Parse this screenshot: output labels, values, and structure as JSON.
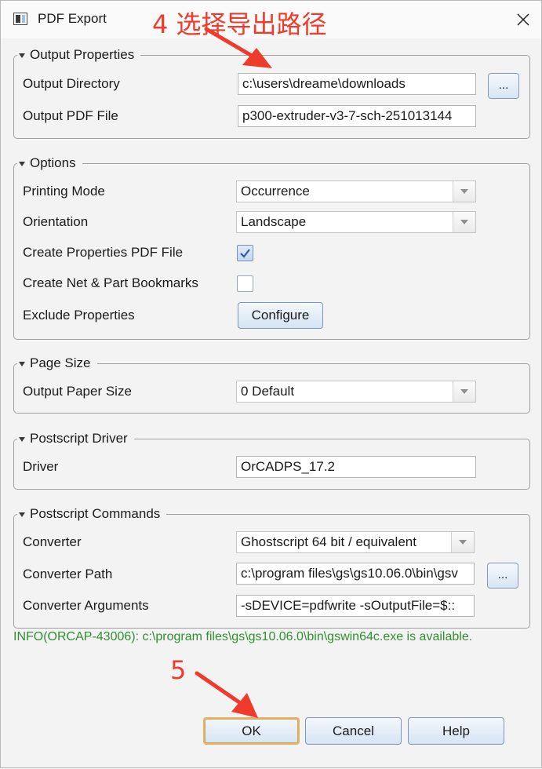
{
  "window": {
    "title": "PDF Export"
  },
  "annotations": {
    "step4": "4  选择导出路径",
    "step5": "5"
  },
  "output_properties": {
    "legend": "Output Properties",
    "dir_label": "Output Directory",
    "dir_value": "c:\\users\\dreame\\downloads",
    "browse_label": "...",
    "pdf_label": "Output PDF File",
    "pdf_value": "p300-extruder-v3-7-sch-251013144"
  },
  "options": {
    "legend": "Options",
    "printing_mode_label": "Printing Mode",
    "printing_mode_value": "Occurrence",
    "orientation_label": "Orientation",
    "orientation_value": "Landscape",
    "create_props_label": "Create Properties PDF File",
    "create_props_checked": true,
    "bookmarks_label": "Create Net & Part Bookmarks",
    "bookmarks_checked": false,
    "exclude_label": "Exclude Properties",
    "configure_label": "Configure"
  },
  "page_size": {
    "legend": "Page Size",
    "paper_label": "Output Paper Size",
    "paper_value": "0 Default"
  },
  "postscript_driver": {
    "legend": "Postscript Driver",
    "driver_label": "Driver",
    "driver_value": "OrCADPS_17.2"
  },
  "postscript_commands": {
    "legend": "Postscript Commands",
    "converter_label": "Converter",
    "converter_value": "Ghostscript 64 bit / equivalent",
    "path_label": "Converter Path",
    "path_value": "c:\\program files\\gs\\gs10.06.0\\bin\\gsv",
    "browse_label": "...",
    "args_label": "Converter Arguments",
    "args_value": "-sDEVICE=pdfwrite -sOutputFile=$::"
  },
  "info_message": "INFO(ORCAP-43006): c:\\program files\\gs\\gs10.06.0\\bin\\gswin64c.exe is available.",
  "buttons": {
    "ok": "OK",
    "cancel": "Cancel",
    "help": "Help"
  },
  "colors": {
    "annotation": "#ef3b2c",
    "info_text": "#2f8f2f",
    "default_button_border": "#e7b25b"
  }
}
